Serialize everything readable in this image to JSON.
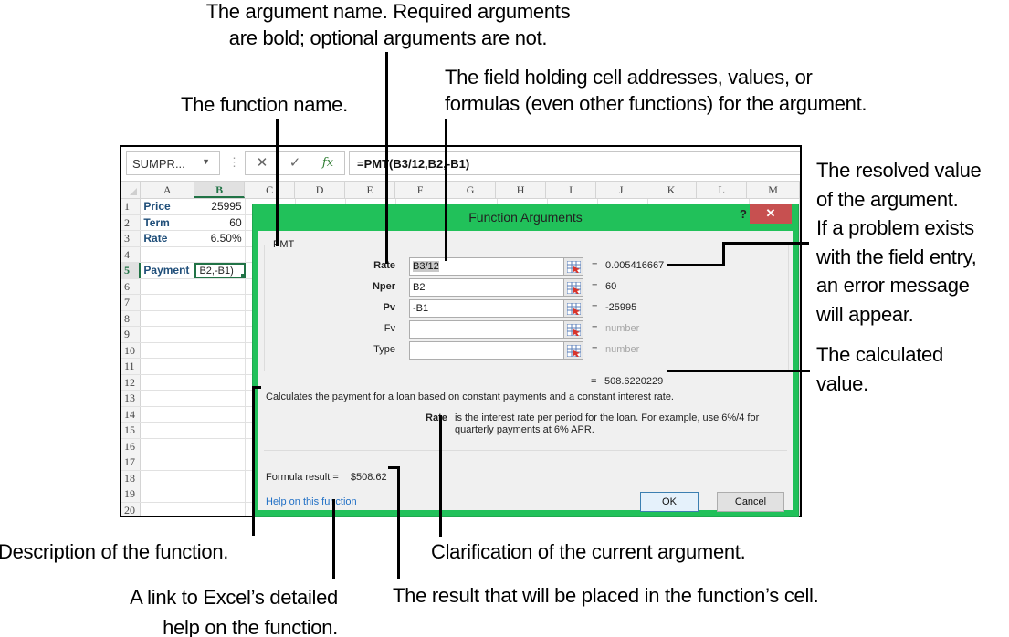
{
  "callouts": {
    "argument_name": [
      "The argument name. Required arguments",
      "are bold; optional arguments are not."
    ],
    "function_name": "The function name.",
    "field": [
      "The field holding cell addresses, values, or",
      "formulas (even other functions) for the argument."
    ],
    "resolved_value": [
      "The resolved value",
      "of the argument.",
      "If a problem exists",
      "with the field entry,",
      "an error message",
      "will appear."
    ],
    "calculated_value": [
      "The calculated",
      "value."
    ],
    "description": "Description of the function.",
    "clarification": "Clarification of the current argument.",
    "help_link": [
      "A link to Excel’s detailed",
      "help on the function."
    ],
    "result": "The result that will be placed in the function’s cell."
  },
  "excel": {
    "name_box": "SUMPR...",
    "formula": "=PMT(B3/12,B2,-B1)",
    "fx_label": "fx",
    "cancel_glyph": "✕",
    "enter_glyph": "✓",
    "columns": [
      "A",
      "B",
      "C",
      "D",
      "E",
      "F",
      "G",
      "H",
      "I",
      "J",
      "K",
      "L",
      "M"
    ],
    "selected_column": "B",
    "rows": [
      {
        "n": "1",
        "a": "Price",
        "b": "25995"
      },
      {
        "n": "2",
        "a": "Term",
        "b": "60"
      },
      {
        "n": "3",
        "a": "Rate",
        "b": "6.50%"
      },
      {
        "n": "4",
        "a": "",
        "b": ""
      },
      {
        "n": "5",
        "a": "Payment",
        "b": "B2,-B1)"
      },
      {
        "n": "6",
        "a": "",
        "b": ""
      },
      {
        "n": "7",
        "a": "",
        "b": ""
      },
      {
        "n": "8",
        "a": "",
        "b": ""
      },
      {
        "n": "9",
        "a": "",
        "b": ""
      },
      {
        "n": "10",
        "a": "",
        "b": ""
      },
      {
        "n": "11",
        "a": "",
        "b": ""
      },
      {
        "n": "12",
        "a": "",
        "b": ""
      },
      {
        "n": "13",
        "a": "",
        "b": ""
      },
      {
        "n": "14",
        "a": "",
        "b": ""
      },
      {
        "n": "15",
        "a": "",
        "b": ""
      },
      {
        "n": "16",
        "a": "",
        "b": ""
      },
      {
        "n": "17",
        "a": "",
        "b": ""
      },
      {
        "n": "18",
        "a": "",
        "b": ""
      },
      {
        "n": "19",
        "a": "",
        "b": ""
      },
      {
        "n": "20",
        "a": "",
        "b": ""
      }
    ],
    "active_row": "5"
  },
  "dialog": {
    "title": "Function Arguments",
    "help_glyph": "?",
    "close_glyph": "✕",
    "function_name": "PMT",
    "arguments": [
      {
        "name": "Rate",
        "required": true,
        "input": "B3/12",
        "value": "0.005416667",
        "placeholder": false
      },
      {
        "name": "Nper",
        "required": true,
        "input": "B2",
        "value": "60",
        "placeholder": false
      },
      {
        "name": "Pv",
        "required": true,
        "input": "-B1",
        "value": "-25995",
        "placeholder": false
      },
      {
        "name": "Fv",
        "required": false,
        "input": "",
        "value": "number",
        "placeholder": true
      },
      {
        "name": "Type",
        "required": false,
        "input": "",
        "value": "number",
        "placeholder": true
      }
    ],
    "equals": "=",
    "calculated_value": "508.6220229",
    "description": "Calculates the payment for a loan based on constant payments and a constant interest rate.",
    "current_arg_name": "Rate",
    "current_arg_desc": "is the interest rate per period for the loan. For example, use 6%/4 for quarterly payments at 6% APR.",
    "formula_result_label": "Formula result =",
    "formula_result_value": "$508.62",
    "help_link": "Help on this function",
    "ok_label": "OK",
    "cancel_label": "Cancel"
  },
  "colors": {
    "dialog_frame": "#21c15a",
    "close_button": "#c75050",
    "excel_green": "#217346",
    "link": "#1f6fc5"
  }
}
